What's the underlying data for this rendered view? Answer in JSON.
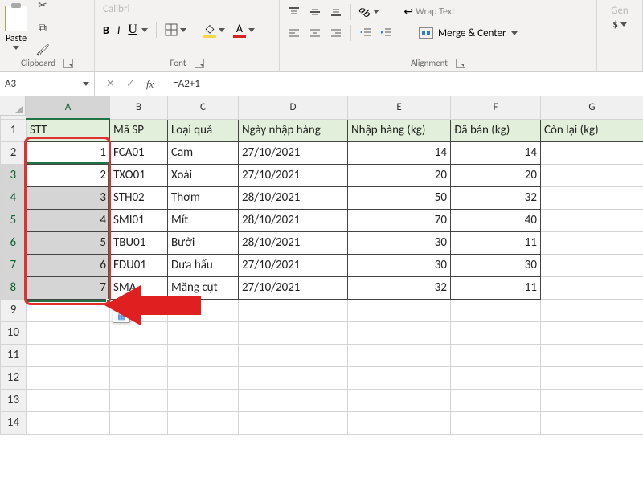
{
  "ribbon": {
    "paste_label": "Paste",
    "clipboard_label": "Clipboard",
    "font_label": "Font",
    "alignment_label": "Alignment",
    "wrap_text_label": "Wrap Text",
    "merge_label": "Merge & Center",
    "gen_label": "Gen"
  },
  "fb": {
    "cellref": "A3",
    "cancel": "✕",
    "confirm": "✓",
    "fx": "fx",
    "formula": "=A2+1"
  },
  "cols": [
    "A",
    "B",
    "C",
    "D",
    "E",
    "F",
    "G"
  ],
  "headers": {
    "stt": "STT",
    "masp": "Mã SP",
    "loai": "Loại quả",
    "ngay": "Ngày nhập hàng",
    "nhap": "Nhập hàng (kg)",
    "daban": "Đã bán (kg)",
    "conlai": "Còn lại (kg)"
  },
  "rows": [
    {
      "stt": "1",
      "masp": "FCA01",
      "loai": "Cam",
      "ngay": "27/10/2021",
      "nhap": "14",
      "daban": "14"
    },
    {
      "stt": "2",
      "masp": "TXO01",
      "loai": "Xoài",
      "ngay": "27/10/2021",
      "nhap": "20",
      "daban": "20"
    },
    {
      "stt": "3",
      "masp": "STH02",
      "loai": "Thơm",
      "ngay": "28/10/2021",
      "nhap": "50",
      "daban": "32"
    },
    {
      "stt": "4",
      "masp": "SMI01",
      "loai": "Mít",
      "ngay": "28/10/2021",
      "nhap": "70",
      "daban": "40"
    },
    {
      "stt": "5",
      "masp": "TBU01",
      "loai": "Bưởi",
      "ngay": "28/10/2021",
      "nhap": "30",
      "daban": "11"
    },
    {
      "stt": "6",
      "masp": "FDU01",
      "loai": "Dưa hấu",
      "ngay": "27/10/2021",
      "nhap": "30",
      "daban": "30"
    },
    {
      "stt": "7",
      "masp": "SMA",
      "loai": "Măng cụt",
      "ngay": "27/10/2021",
      "nhap": "32",
      "daban": "11"
    }
  ]
}
